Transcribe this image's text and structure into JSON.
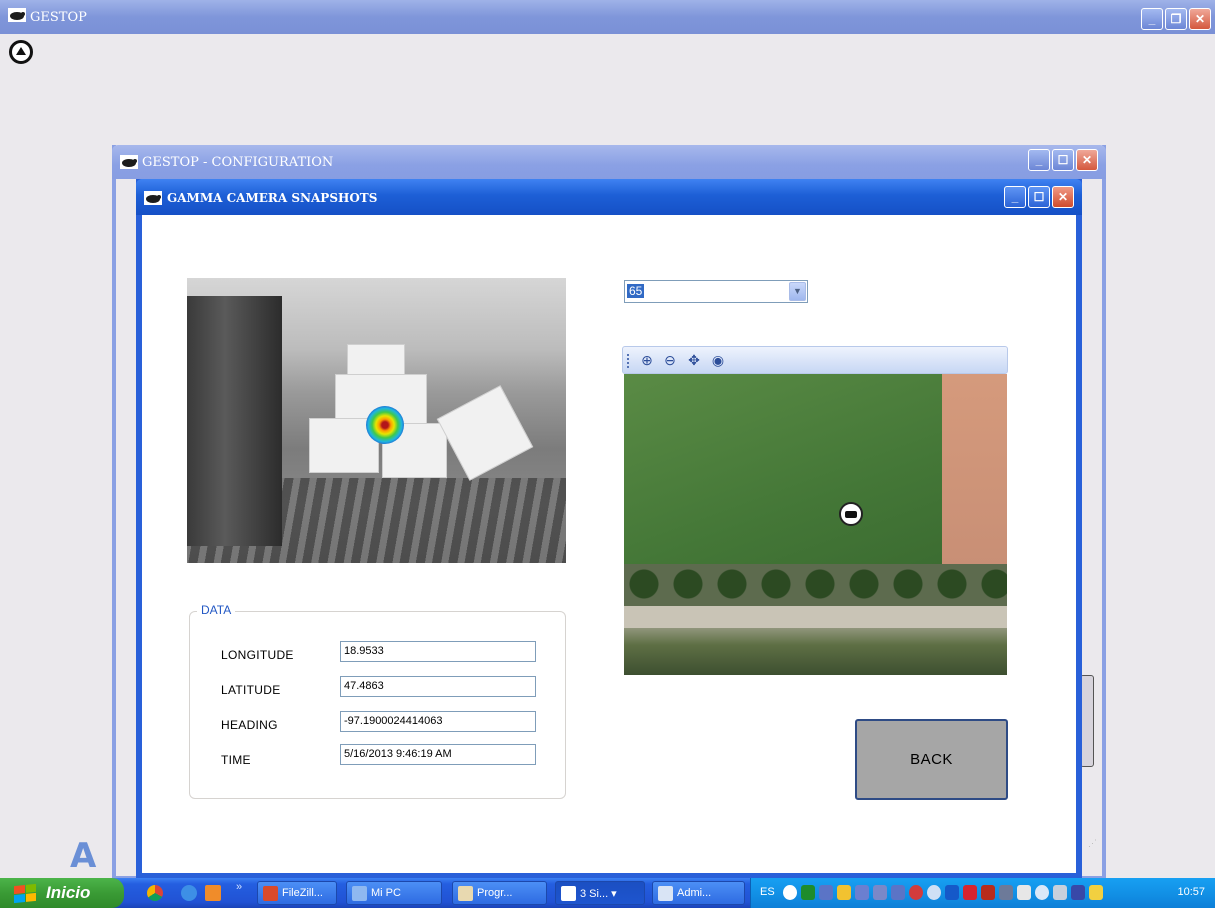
{
  "main_window": {
    "title": "GESTOP",
    "controls": {
      "minimize": "_",
      "restore": "❐",
      "close": "✕"
    }
  },
  "config_window": {
    "title": "GESTOP - CONFIGURATION",
    "controls": {
      "minimize": "_",
      "maximize": "☐",
      "close": "✕"
    }
  },
  "gamma_window": {
    "title": "GAMMA CAMERA SNAPSHOTS",
    "controls": {
      "minimize": "_",
      "maximize": "☐",
      "close": "✕"
    },
    "snapshot_select": {
      "value": "65"
    },
    "map_toolbar": {
      "zoom_in": "🔍+",
      "zoom_out": "🔍−",
      "pan": "✋",
      "center": "⊙"
    },
    "data": {
      "legend": "DATA",
      "longitude_label": "LONGITUDE",
      "longitude": "18.9533",
      "latitude_label": "LATITUDE",
      "latitude": "47.4863",
      "heading_label": "HEADING",
      "heading": "-97.1900024414063",
      "time_label": "TIME",
      "time": "5/16/2013 9:46:19 AM"
    },
    "back_label": "BACK"
  },
  "desktop": {
    "letter": "A"
  },
  "taskbar": {
    "start_label": "Inicio",
    "quicklaunch_more": "»",
    "tasks": [
      {
        "label": "FileZill...",
        "color": "#d94a2a"
      },
      {
        "label": "Mi PC",
        "color": "#8fb8f0"
      },
      {
        "label": "Progr...",
        "color": "#e8d9b0"
      },
      {
        "label": "3 Si...  ▾",
        "color": "#2b2b2b"
      },
      {
        "label": "Admi...",
        "color": "#d9e4f5"
      }
    ],
    "tray": {
      "language": "ES",
      "clock": "10:57"
    }
  },
  "colors": {
    "gamma_frame": "#2960d9",
    "config_frame": "#8aa0e4",
    "data_legend": "#2358c4",
    "back_button": "#a6a6a6"
  }
}
